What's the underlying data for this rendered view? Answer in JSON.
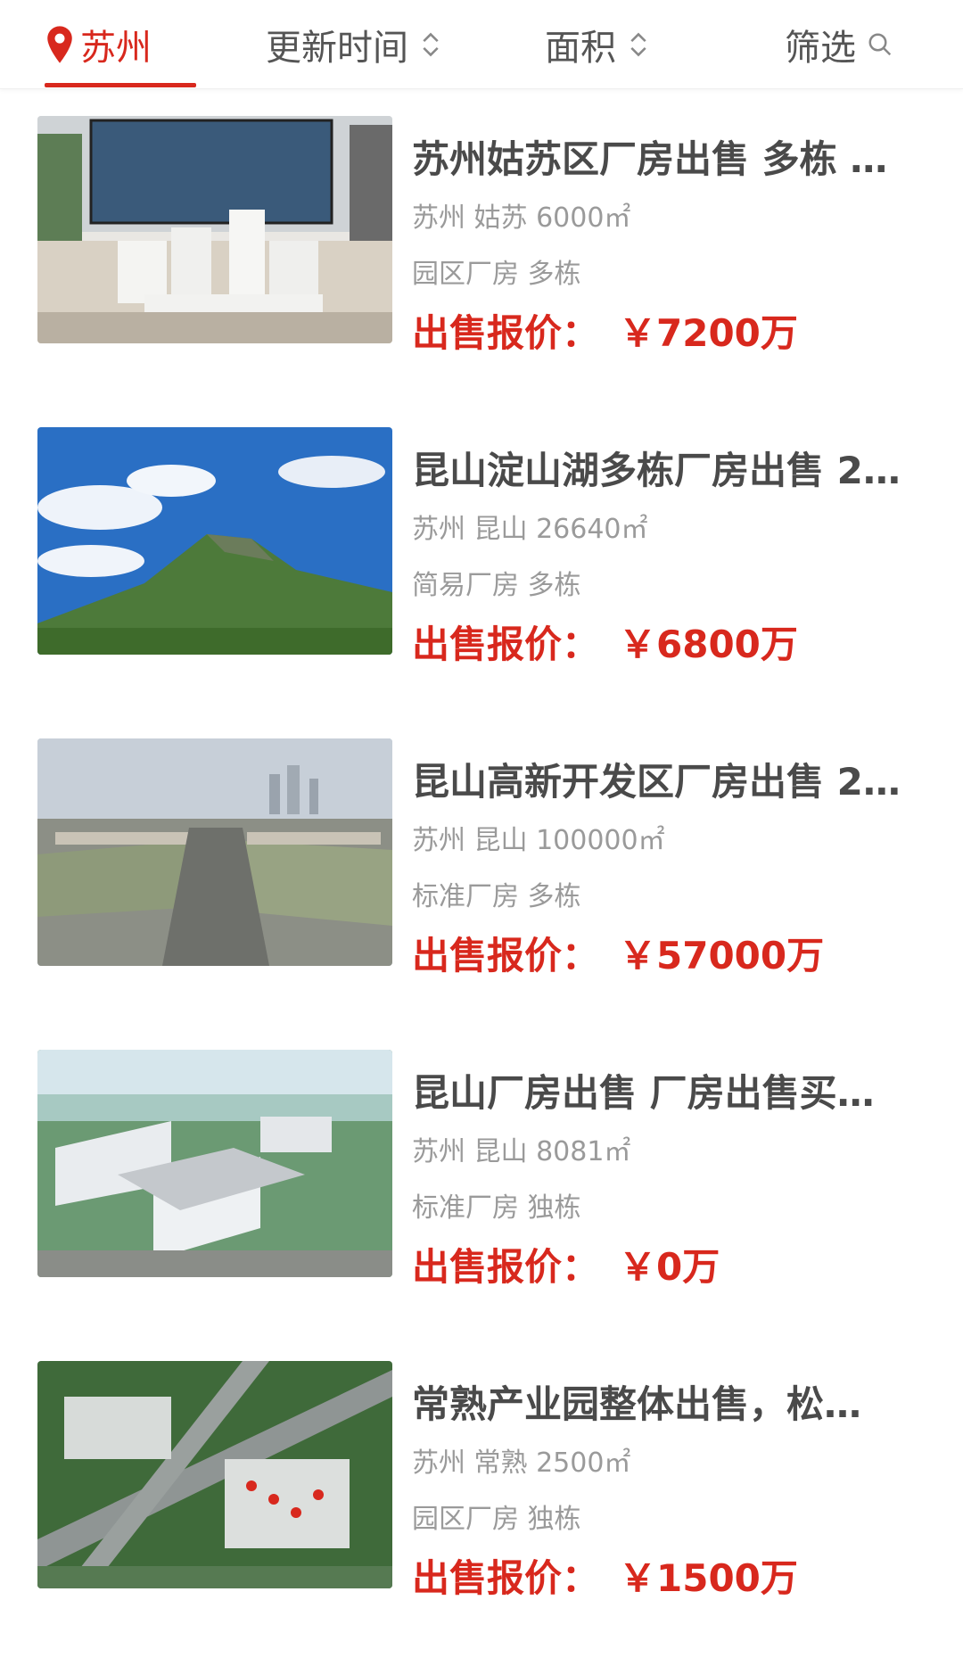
{
  "filters": {
    "city": "苏州",
    "update_time": "更新时间",
    "area": "面积",
    "screen": "筛选"
  },
  "colors": {
    "accent": "#d8281d",
    "title": "#4a4a4a",
    "meta": "#9a9a9a"
  },
  "listings": [
    {
      "title": "苏州姑苏区厂房出售 多栋 …",
      "location": "苏州 姑苏 6000㎡",
      "tags": "园区厂房 多栋",
      "price_label": "出售报价：",
      "price_value": "￥7200万"
    },
    {
      "title": "昆山淀山湖多栋厂房出售 2…",
      "location": "苏州 昆山 26640㎡",
      "tags": "简易厂房 多栋",
      "price_label": "出售报价：",
      "price_value": "￥6800万"
    },
    {
      "title": "昆山高新开发区厂房出售 2…",
      "location": "苏州 昆山 100000㎡",
      "tags": "标准厂房 多栋",
      "price_label": "出售报价：",
      "price_value": "￥57000万"
    },
    {
      "title": "昆山厂房出售 厂房出售买…",
      "location": "苏州 昆山 8081㎡",
      "tags": "标准厂房 独栋",
      "price_label": "出售报价：",
      "price_value": "￥0万"
    },
    {
      "title": "常熟产业园整体出售，松…",
      "location": "苏州 常熟 2500㎡",
      "tags": "园区厂房 独栋",
      "price_label": "出售报价：",
      "price_value": "￥1500万"
    }
  ]
}
